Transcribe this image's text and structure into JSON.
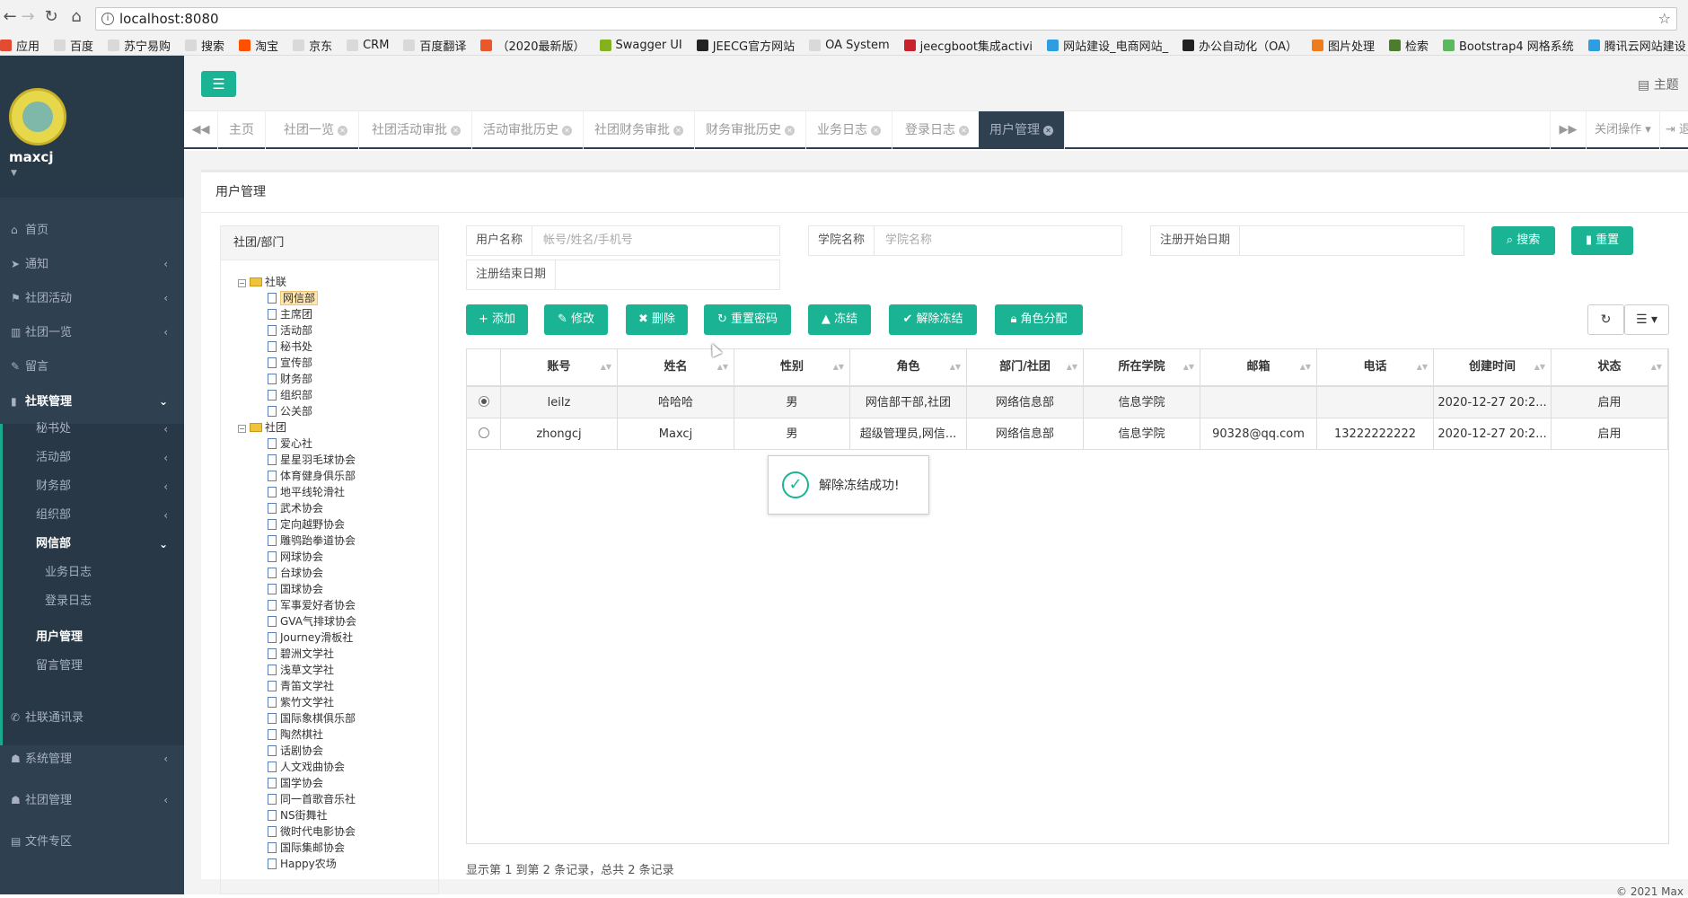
{
  "browser": {
    "url": "localhost:8080",
    "bookmarks": [
      {
        "label": "应用",
        "color": "#e34a32"
      },
      {
        "label": "百度",
        "color": "#d9d9d9"
      },
      {
        "label": "苏宁易购",
        "color": "#d9d9d9"
      },
      {
        "label": "搜索",
        "color": "#d9d9d9"
      },
      {
        "label": "淘宝",
        "color": "#ff5000"
      },
      {
        "label": "京东",
        "color": "#d9d9d9"
      },
      {
        "label": "CRM",
        "color": "#d9d9d9"
      },
      {
        "label": "百度翻译",
        "color": "#d9d9d9"
      },
      {
        "label": "（2020最新版）",
        "color": "#e8582c"
      },
      {
        "label": "Swagger UI",
        "color": "#85b11e"
      },
      {
        "label": "JEECG官方网站",
        "color": "#222222"
      },
      {
        "label": "OA System",
        "color": "#d9d9d9"
      },
      {
        "label": "jeecgboot集成activi",
        "color": "#c8232c"
      },
      {
        "label": "网站建设_电商网站_",
        "color": "#2f9ee0"
      },
      {
        "label": "办公自动化（OA）",
        "color": "#222222"
      },
      {
        "label": "图片处理",
        "color": "#f07b1c"
      },
      {
        "label": "检索",
        "color": "#4b7d2c"
      },
      {
        "label": "Bootstrap4 网格系统",
        "color": "#5cb85c"
      },
      {
        "label": "腾讯云网站建设",
        "color": "#2f9ee0"
      }
    ]
  },
  "sidebar": {
    "username": "maxcj",
    "menu": [
      {
        "icon": "⌂",
        "label": "首页",
        "arrow": ""
      },
      {
        "icon": "➤",
        "label": "通知",
        "arrow": "‹"
      },
      {
        "icon": "⚑",
        "label": "社团活动",
        "arrow": "‹"
      },
      {
        "icon": "▥",
        "label": "社团一览",
        "arrow": "‹"
      },
      {
        "icon": "✎",
        "label": "留言",
        "arrow": ""
      },
      {
        "icon": "▮",
        "label": "社联管理",
        "arrow": "⌄"
      }
    ],
    "sub": [
      {
        "label": "秘书处",
        "arrow": "‹"
      },
      {
        "label": "活动部",
        "arrow": "‹"
      },
      {
        "label": "财务部",
        "arrow": "‹"
      },
      {
        "label": "组织部",
        "arrow": "‹"
      },
      {
        "label": "网信部",
        "arrow": "⌄"
      }
    ],
    "sub2": [
      "业务日志",
      "登录日志"
    ],
    "sub3": [
      "用户管理",
      "留言管理"
    ],
    "bottom": [
      {
        "icon": "✆",
        "label": "社联通讯录",
        "arrow": ""
      },
      {
        "icon": "☗",
        "label": "系统管理",
        "arrow": "‹"
      },
      {
        "icon": "☗",
        "label": "社团管理",
        "arrow": "‹"
      },
      {
        "icon": "▤",
        "label": "文件专区",
        "arrow": ""
      }
    ]
  },
  "header": {
    "theme": "主题"
  },
  "tabs": {
    "items": [
      "主页",
      "社团一览",
      "社团活动审批",
      "活动审批历史",
      "社团财务审批",
      "财务审批历史",
      "业务日志",
      "登录日志",
      "用户管理"
    ],
    "close_ops": "关闭操作",
    "logout": "退"
  },
  "panel": {
    "title": "用户管理"
  },
  "tree": {
    "header": "社团/部门",
    "root1": "社联",
    "root1_children": [
      "网信部",
      "主席团",
      "活动部",
      "秘书处",
      "宣传部",
      "财务部",
      "组织部",
      "公关部"
    ],
    "root2": "社团",
    "root2_children": [
      "爱心社",
      "星星羽毛球协会",
      "体育健身俱乐部",
      "地平线轮滑社",
      "武术协会",
      "定向越野协会",
      "雕鸮跆拳道协会",
      "网球协会",
      "台球协会",
      "国球协会",
      "军事爱好者协会",
      "GVA气排球协会",
      "Journey滑板社",
      "碧洲文学社",
      "浅草文学社",
      "青笛文学社",
      "紫竹文学社",
      "国际象棋俱乐部",
      "陶然棋社",
      "话剧协会",
      "人文戏曲协会",
      "国学协会",
      "同一首歌音乐社",
      "NS街舞社",
      "微时代电影协会",
      "国际集邮协会",
      "Happy农场"
    ]
  },
  "search": {
    "username_label": "用户名称",
    "username_ph": "帐号/姓名/手机号",
    "college_label": "学院名称",
    "college_ph": "学院名称",
    "start_label": "注册开始日期",
    "end_label": "注册结束日期",
    "search_btn": "搜索",
    "reset_btn": "重置"
  },
  "toolbar": {
    "add": "添加",
    "edit": "修改",
    "delete": "删除",
    "resetpwd": "重置密码",
    "freeze": "冻结",
    "unfreeze": "解除冻结",
    "role": "角色分配"
  },
  "table": {
    "columns": [
      "账号",
      "姓名",
      "性别",
      "角色",
      "部门/社团",
      "所在学院",
      "邮箱",
      "电话",
      "创建时间",
      "状态"
    ],
    "rows": [
      {
        "selected": true,
        "cells": [
          "leilz",
          "哈哈哈",
          "男",
          "网信部干部,社团",
          "网络信息部",
          "信息学院",
          "",
          "",
          "2020-12-27 20:2...",
          "启用"
        ]
      },
      {
        "selected": false,
        "cells": [
          "zhongcj",
          "Maxcj",
          "男",
          "超级管理员,网信...",
          "网络信息部",
          "信息学院",
          "90328@qq.com",
          "13222222222",
          "2020-12-27 20:2...",
          "启用"
        ]
      }
    ],
    "pagination": "显示第 1 到第 2 条记录，总共 2 条记录"
  },
  "toast": {
    "message": "解除冻结成功!"
  },
  "footer": {
    "copyright": "© 2021 Max"
  },
  "colors": {
    "primary": "#1ab394",
    "sidebar": "#2f4050"
  }
}
